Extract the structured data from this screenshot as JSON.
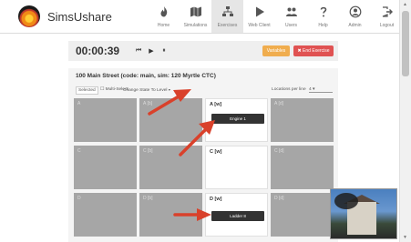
{
  "app": {
    "brand": "SimsUshare"
  },
  "nav": {
    "items": [
      {
        "label": "Home",
        "icon": "flame-icon"
      },
      {
        "label": "Simulations",
        "icon": "map-icon"
      },
      {
        "label": "Exercises",
        "icon": "org-chart-icon",
        "active": true
      },
      {
        "label": "Web Client",
        "icon": "play-icon"
      },
      {
        "label": "Users",
        "icon": "users-icon"
      },
      {
        "label": "Help",
        "icon": "question-icon"
      },
      {
        "label": "Admin",
        "icon": "user-circle-icon"
      },
      {
        "label": "Logout",
        "icon": "logout-icon"
      }
    ]
  },
  "exercise": {
    "timer": "00:00:39",
    "controls": {
      "rewind": "⏮",
      "play": "▶",
      "pause": "⏸"
    },
    "variables_label": "Variables",
    "end_label": "✖ End Exercise",
    "colors": {
      "variables": "#f0ad4e",
      "end": "#e05252"
    }
  },
  "panel": {
    "title": "100 Main Street (code: main, sim: 120 Myrtle CTC)",
    "toolbar": {
      "select_label": "Selected",
      "multi_select_label": "☐ Multi-Select",
      "change_state_label": "Change State To",
      "change_state_value": "Level",
      "locations_label": "Locations per line",
      "locations_value": "4"
    },
    "cells": [
      {
        "label": "A",
        "filled": false
      },
      {
        "label": "A [b]",
        "filled": false
      },
      {
        "label": "A [w]",
        "filled": true,
        "unit": "Engine 1"
      },
      {
        "label": "A [d]",
        "filled": false
      },
      {
        "label": "C",
        "filled": false
      },
      {
        "label": "C [b]",
        "filled": false
      },
      {
        "label": "C [w]",
        "filled": true
      },
      {
        "label": "C [d]",
        "filled": false
      },
      {
        "label": "D",
        "filled": false
      },
      {
        "label": "D [b]",
        "filled": false
      },
      {
        "label": "D [w]",
        "filled": true,
        "unit": "Ladder 8"
      },
      {
        "label": "D [d]",
        "filled": false
      }
    ]
  },
  "annotations": {
    "arrow_color": "#d9412b"
  }
}
